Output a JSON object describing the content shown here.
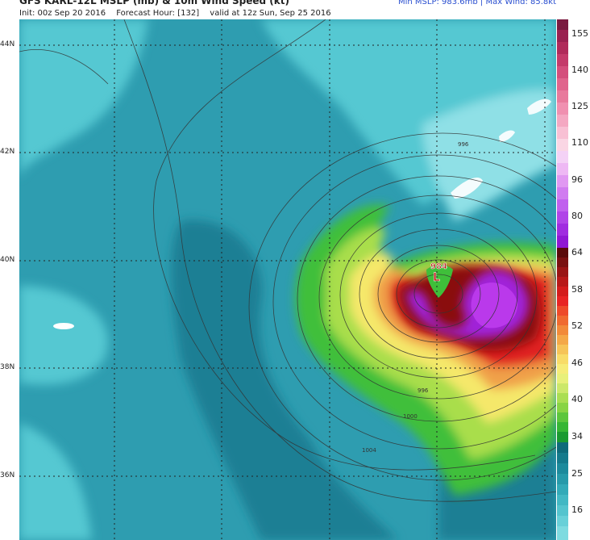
{
  "header": {
    "title": "GFS KARL-12L MSLP (mb) & 10m Wind Speed (kt)",
    "init": "Init: 00z Sep 20 2016",
    "forecast_hour": "Forecast Hour: [132]",
    "valid": "valid at 12z Sun, Sep 25 2016",
    "stats": "Min MSLP: 983.6mb | Max Wind: 85.8kt"
  },
  "map": {
    "lat_labels": [
      "44N",
      "42N",
      "40N",
      "38N",
      "36N"
    ],
    "center_pressure": "984",
    "low_marker": "L",
    "isobar_labels": [
      "996",
      "996",
      "1000",
      "1004"
    ]
  },
  "colorbar": {
    "labels": [
      "155",
      "140",
      "125",
      "110",
      "96",
      "80",
      "64",
      "58",
      "52",
      "46",
      "40",
      "34",
      "25",
      "16"
    ]
  },
  "colors": {
    "calm": "#55c8d2",
    "teal": "#2e9db0",
    "deep_teal": "#1a7f94",
    "green": "#3fbf3a",
    "light_green": "#a9de4b",
    "yellow": "#f5e86a",
    "orange": "#f0a048",
    "red": "#e02020",
    "dark_red": "#8a1010",
    "purple": "#a020d8",
    "light_purple": "#c040f0",
    "isobar": "#333333",
    "title_blue": "#2a4fd0"
  }
}
